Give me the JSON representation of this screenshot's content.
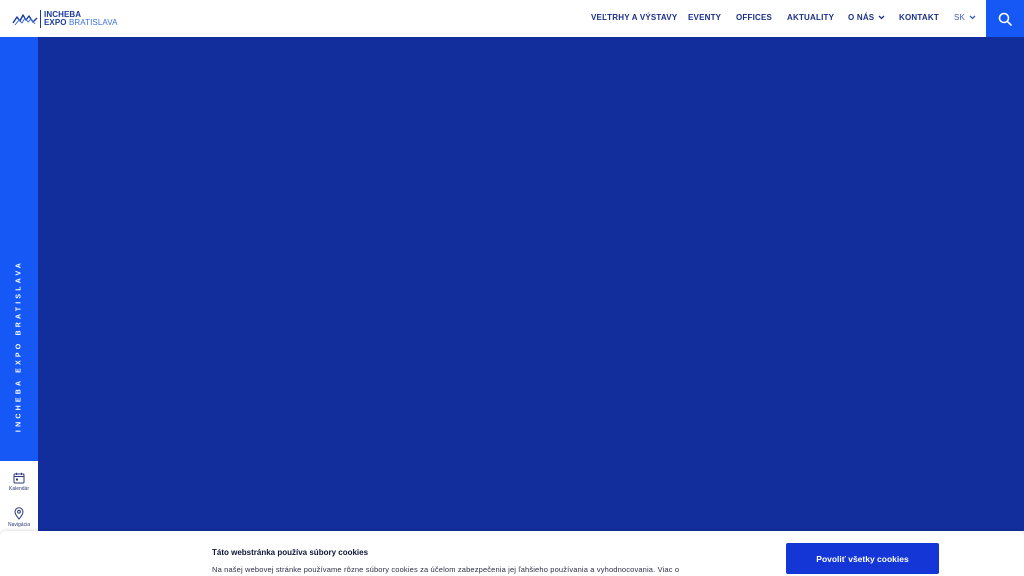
{
  "brand": {
    "line1": "INCHEBA",
    "line2_strong": "EXPO",
    "line2_light": "BRATISLAVA"
  },
  "nav": {
    "items": [
      {
        "label": "VEĽTRHY A VÝSTAVY"
      },
      {
        "label": "EVENTY"
      },
      {
        "label": "OFFICES"
      },
      {
        "label": "AKTUALITY"
      },
      {
        "label": "O NÁS"
      },
      {
        "label": "KONTAKT"
      }
    ],
    "language": "SK"
  },
  "sidebar": {
    "vertical_text": "INCHEBA EXPO BRATISLAVA",
    "tools": [
      {
        "label": "Kalendár",
        "icon": "calendar-icon"
      },
      {
        "label": "Navigácia",
        "icon": "map-pin-icon"
      }
    ]
  },
  "cookie": {
    "title": "Táto webstránka používa súbory cookies",
    "text": "Na našej webovej stránke používame rôzne súbory cookies za účelom zabezpečenia jej ľahšieho používania a vyhodnocovania. Viac o",
    "accept_label": "Povoliť všetky cookies"
  },
  "colors": {
    "accent": "#1558f5",
    "hero": "#112e9c",
    "nav_text": "#1a2f8c",
    "cookie_button": "#1436d6"
  }
}
